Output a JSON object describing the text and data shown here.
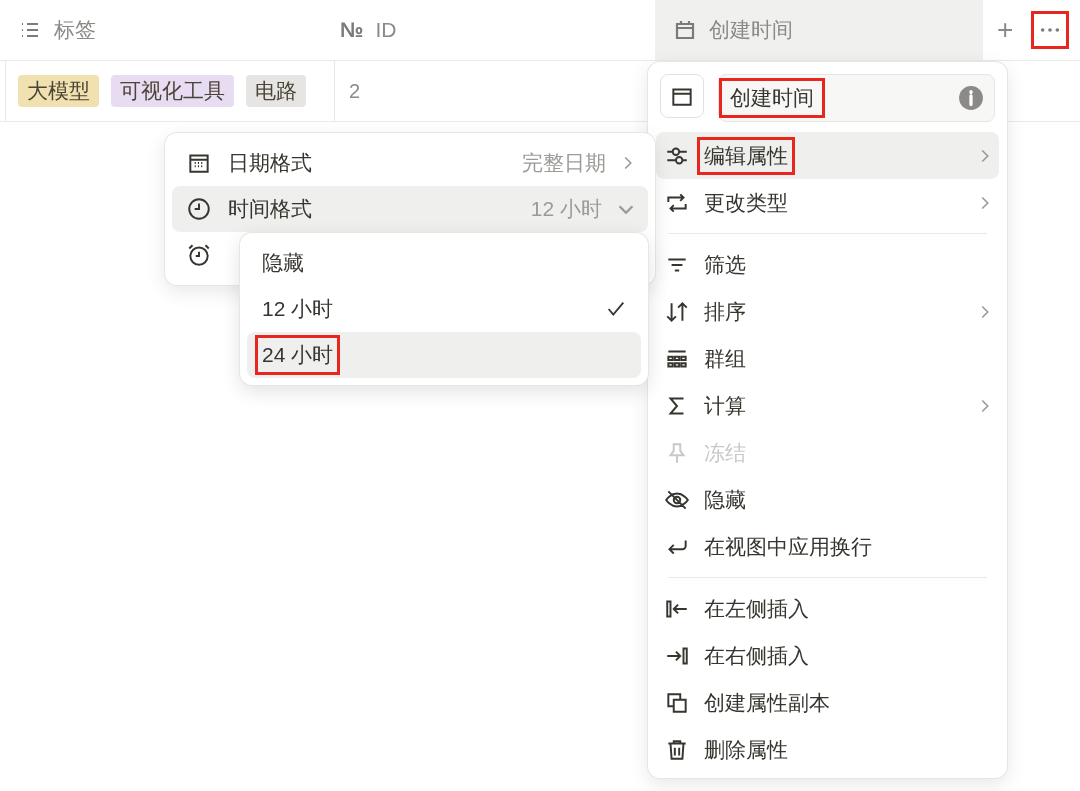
{
  "table": {
    "columns": [
      {
        "label": "标签",
        "selected": false
      },
      {
        "label": "ID",
        "icon_char": "№",
        "selected": false
      },
      {
        "label": "创建时间",
        "selected": true
      }
    ],
    "add_button": "+",
    "more_button": {
      "annotated": true
    },
    "rows": [
      {
        "tags": [
          {
            "label": "大模型",
            "color": "#f1e1b0"
          },
          {
            "label": "可视化工具",
            "color": "#e8dcf3"
          },
          {
            "label": "电路",
            "color": "#e6e5e3"
          }
        ],
        "id": "2"
      }
    ]
  },
  "property_menu": {
    "name_field": {
      "value": "创建时间",
      "annotated": true
    },
    "sections": [
      [
        {
          "label": "编辑属性",
          "chevron": true,
          "disabled": false,
          "selected": true,
          "annotated": true
        },
        {
          "label": "更改类型",
          "chevron": true,
          "disabled": false,
          "selected": false,
          "annotated": false
        }
      ],
      [
        {
          "label": "筛选",
          "chevron": false,
          "disabled": false,
          "selected": false,
          "annotated": false
        },
        {
          "label": "排序",
          "chevron": true,
          "disabled": false,
          "selected": false,
          "annotated": false
        },
        {
          "label": "群组",
          "chevron": false,
          "disabled": false,
          "selected": false,
          "annotated": false
        },
        {
          "label": "计算",
          "chevron": true,
          "disabled": false,
          "selected": false,
          "annotated": false
        },
        {
          "label": "冻结",
          "chevron": false,
          "disabled": true,
          "selected": false,
          "annotated": false
        },
        {
          "label": "隐藏",
          "chevron": false,
          "disabled": false,
          "selected": false,
          "annotated": false
        },
        {
          "label": "在视图中应用换行",
          "chevron": false,
          "disabled": false,
          "selected": false,
          "annotated": false
        }
      ],
      [
        {
          "label": "在左侧插入",
          "chevron": false,
          "disabled": false,
          "selected": false,
          "annotated": false
        },
        {
          "label": "在右侧插入",
          "chevron": false,
          "disabled": false,
          "selected": false,
          "annotated": false
        },
        {
          "label": "创建属性副本",
          "chevron": false,
          "disabled": false,
          "selected": false,
          "annotated": false
        },
        {
          "label": "删除属性",
          "chevron": false,
          "disabled": false,
          "selected": false,
          "annotated": false
        }
      ]
    ]
  },
  "format_menu": {
    "items": [
      {
        "label": "日期格式",
        "value": "完整日期",
        "kind": "submenu",
        "selected": false
      },
      {
        "label": "时间格式",
        "value": "12 小时",
        "kind": "dropdown",
        "selected": true
      },
      {
        "kind": "covered",
        "selected": false
      }
    ]
  },
  "time_format_options": [
    {
      "label": "隐藏",
      "checked": false,
      "selected": false,
      "annotated": false
    },
    {
      "label": "12 小时",
      "checked": true,
      "selected": false,
      "annotated": false
    },
    {
      "label": "24 小时",
      "checked": false,
      "selected": true,
      "annotated": true
    }
  ]
}
